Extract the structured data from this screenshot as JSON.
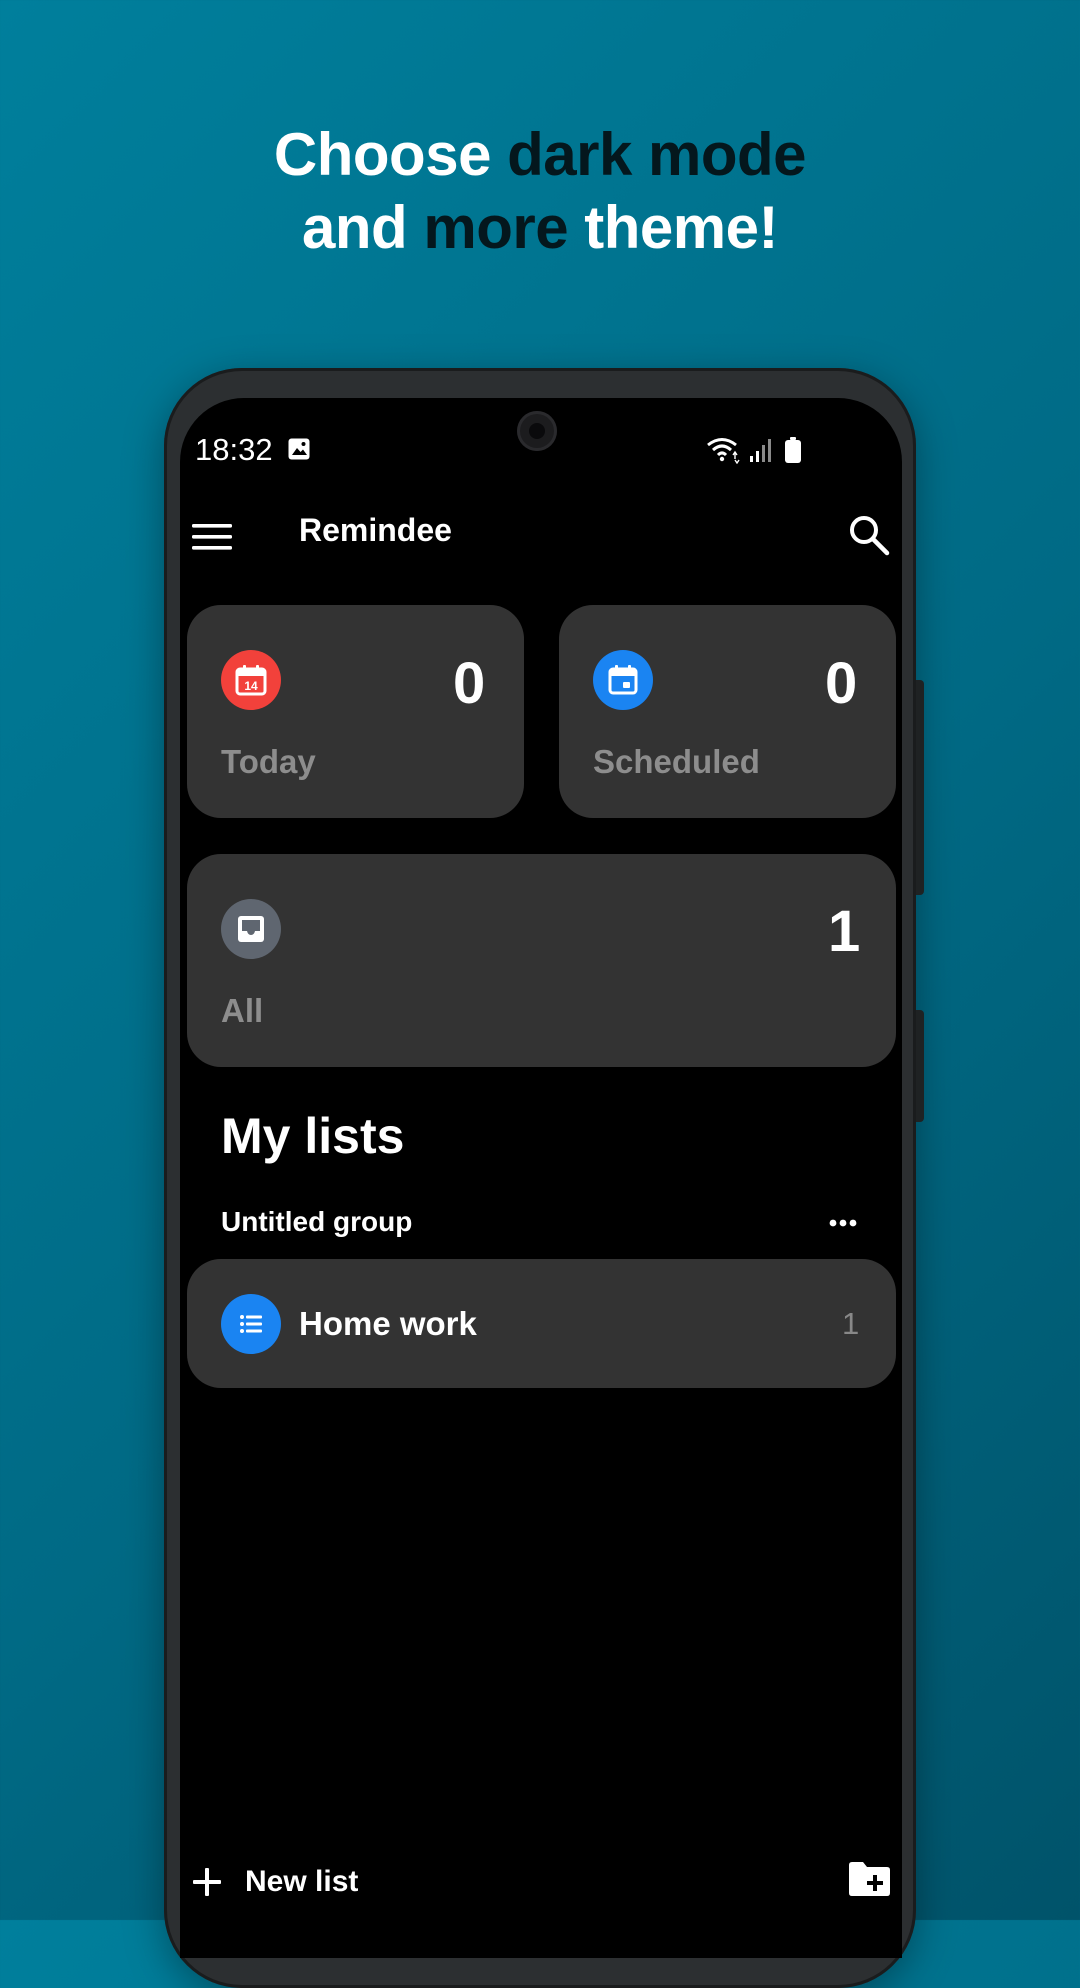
{
  "promo": {
    "line1_prefix": "Choose ",
    "line1_highlight": "dark mode",
    "line2_prefix": "and ",
    "line2_highlight": "more",
    "line2_suffix": " theme!"
  },
  "status_bar": {
    "time": "18:32"
  },
  "app_bar": {
    "title": "Remindee"
  },
  "cards": {
    "today": {
      "label": "Today",
      "count": "0",
      "day_number": "14",
      "icon_color": "#f2413b"
    },
    "scheduled": {
      "label": "Scheduled",
      "count": "0",
      "icon_color": "#1a84f2"
    },
    "all": {
      "label": "All",
      "count": "1",
      "icon_color": "#5f6670"
    }
  },
  "my_lists": {
    "title": "My lists",
    "group": {
      "name": "Untitled group",
      "lists": [
        {
          "name": "Home work",
          "count": "1",
          "icon_color": "#1a84f2"
        }
      ]
    }
  },
  "bottom_bar": {
    "new_list_label": "New list"
  },
  "colors": {
    "background_start": "#007f9c",
    "background_end": "#00536a",
    "card": "#333333",
    "screen": "#000000"
  }
}
